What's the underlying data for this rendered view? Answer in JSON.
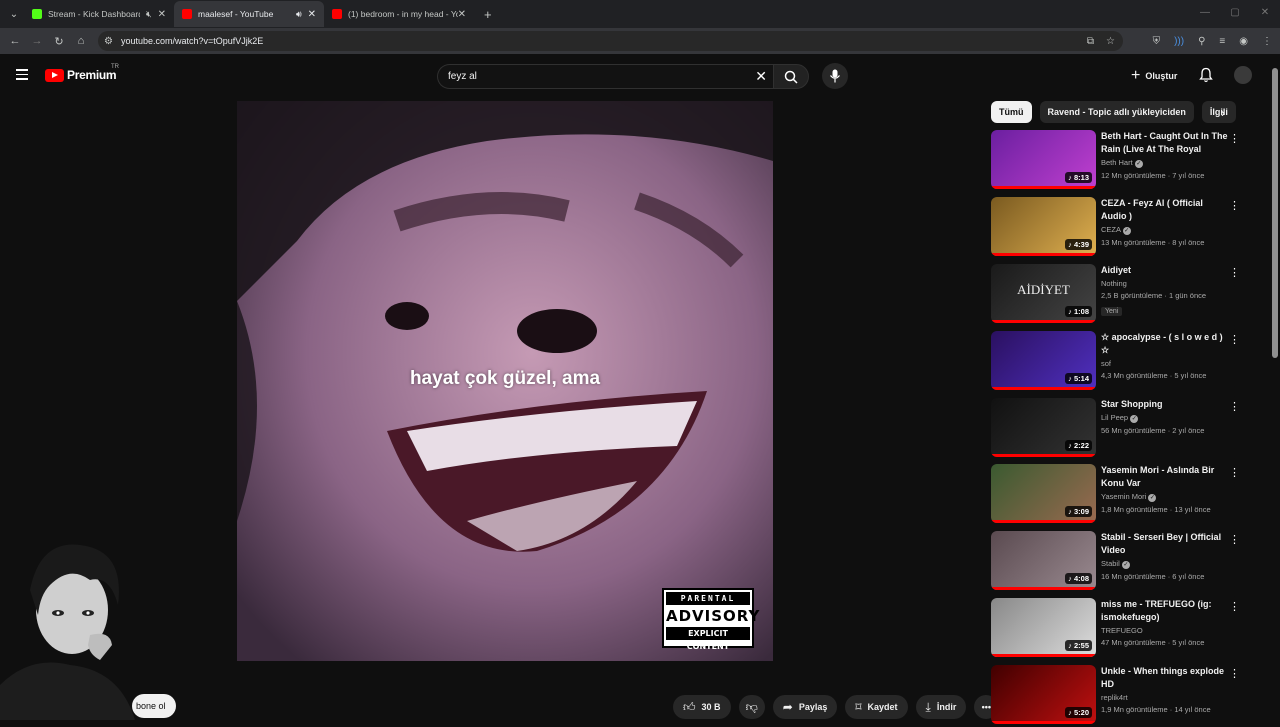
{
  "browser": {
    "tabs": [
      {
        "title": "Stream - Kick Dashboard",
        "favicon_color": "#53fc18"
      },
      {
        "title": "maalesef - YouTube",
        "favicon_color": "#ff0000"
      },
      {
        "title": "(1) bedroom - in my head - You",
        "favicon_color": "#ff0000"
      }
    ],
    "url": "youtube.com/watch?v=tOpufVJjk2E"
  },
  "youtube": {
    "logo_text": "Premium",
    "country": "TR",
    "search_value": "feyz al",
    "create_label": "Oluştur"
  },
  "player": {
    "caption": "hayat çok güzel, ama",
    "advisory": {
      "line1": "PARENTAL",
      "line2": "ADVISORY",
      "line3": "EXPLICIT CONTENT"
    }
  },
  "actions": {
    "subscribe": "bone ol",
    "likes": "30 B",
    "share": "Paylaş",
    "save": "Kaydet",
    "download": "İndir"
  },
  "chips": [
    "Tümü",
    "Ravend - Topic adlı yükleyiciden",
    "İlgili"
  ],
  "recommendations": [
    {
      "title": "Beth Hart - Caught Out In The Rain (Live At The Royal Albert ...",
      "channel": "Beth Hart",
      "verified": true,
      "views": "12 Mn görüntüleme · 7 yıl önce",
      "duration": "8:13",
      "colors": [
        "#6b1fa0",
        "#c040d0"
      ]
    },
    {
      "title": "CEZA - Feyz Al ( Official Audio )",
      "channel": "CEZA",
      "verified": true,
      "views": "13 Mn görüntüleme · 8 yıl önce",
      "duration": "4:39",
      "colors": [
        "#7a5a20",
        "#e0b050"
      ]
    },
    {
      "title": "Aidiyet",
      "channel": "Nothing",
      "verified": false,
      "views": "2,5 B görüntüleme · 1 gün önce",
      "duration": "1:08",
      "badge": "Yeni",
      "thumb_text": "AİDİYET",
      "colors": [
        "#1a1a1a",
        "#444"
      ]
    },
    {
      "title": "☆ apocalypse - ( s l o w e d ) ☆",
      "channel": "sof",
      "verified": false,
      "views": "4,3 Mn görüntüleme · 5 yıl önce",
      "duration": "5:14",
      "colors": [
        "#2a1060",
        "#5030c0"
      ]
    },
    {
      "title": "Star Shopping",
      "channel": "Lil Peep",
      "verified": true,
      "views": "56 Mn görüntüleme · 2 yıl önce",
      "duration": "2:22",
      "colors": [
        "#111",
        "#333"
      ]
    },
    {
      "title": "Yasemin Mori - Aslında Bir Konu Var",
      "channel": "Yasemin Mori",
      "verified": true,
      "views": "1,8 Mn görüntüleme · 13 yıl önce",
      "duration": "3:09",
      "colors": [
        "#3a5a30",
        "#9a6a50"
      ]
    },
    {
      "title": "Stabil - Serseri Bey | Official Video",
      "channel": "Stabil",
      "verified": true,
      "views": "16 Mn görüntüleme · 6 yıl önce",
      "duration": "4:08",
      "colors": [
        "#5a4a50",
        "#9a8a90"
      ]
    },
    {
      "title": "miss me - TREFUEGO (ig: ismokefuego)",
      "channel": "TREFUEGO",
      "verified": false,
      "views": "47 Mn görüntüleme · 5 yıl önce",
      "duration": "2:55",
      "colors": [
        "#888",
        "#ddd"
      ]
    },
    {
      "title": "Unkle - When things explode HD",
      "channel": "replik4rt",
      "verified": false,
      "views": "1,9 Mn görüntüleme · 14 yıl önce",
      "duration": "5:20",
      "colors": [
        "#400000",
        "#c01010"
      ]
    }
  ]
}
